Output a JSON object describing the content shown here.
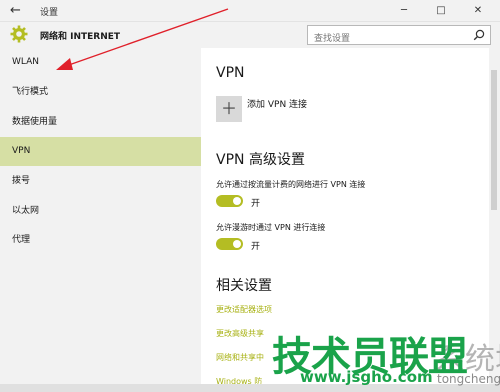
{
  "window": {
    "title": "设置",
    "minimize_glyph": "─",
    "maximize_glyph": "□",
    "close_glyph": "✕",
    "back_glyph": "←"
  },
  "header": {
    "title": "网络和 INTERNET",
    "icon": "gear-icon",
    "search_placeholder": "查找设置"
  },
  "sidebar": {
    "items": [
      {
        "label": "WLAN",
        "active": false
      },
      {
        "label": "飞行模式",
        "active": false
      },
      {
        "label": "数据使用量",
        "active": false
      },
      {
        "label": "VPN",
        "active": true
      },
      {
        "label": "拨号",
        "active": false
      },
      {
        "label": "以太网",
        "active": false
      },
      {
        "label": "代理",
        "active": false
      }
    ]
  },
  "main": {
    "vpn_heading": "VPN",
    "add_vpn_icon": "＋",
    "add_vpn_label": "添加 VPN 连接",
    "advanced_heading": "VPN 高级设置",
    "option1_label": "允许通过按流量计费的网络进行 VPN 连接",
    "option1_state": "开",
    "option1_on": true,
    "option2_label": "允许漫游时通过 VPN 进行连接",
    "option2_state": "开",
    "option2_on": true,
    "related_heading": "相关设置",
    "links": [
      "更改适配器选项",
      "更改高级共享",
      "网络和共享中",
      "Windows 防"
    ]
  },
  "watermark": {
    "text_cn": "技术员联盟",
    "ghost": "系统城",
    "url": "www.jsgho.com",
    "url2": "tongcheng"
  },
  "colors": {
    "accent": "#b4bd23",
    "active_nav": "#d6dfa4",
    "arrow": "#e0202a",
    "watermark": "#1aa34a"
  }
}
